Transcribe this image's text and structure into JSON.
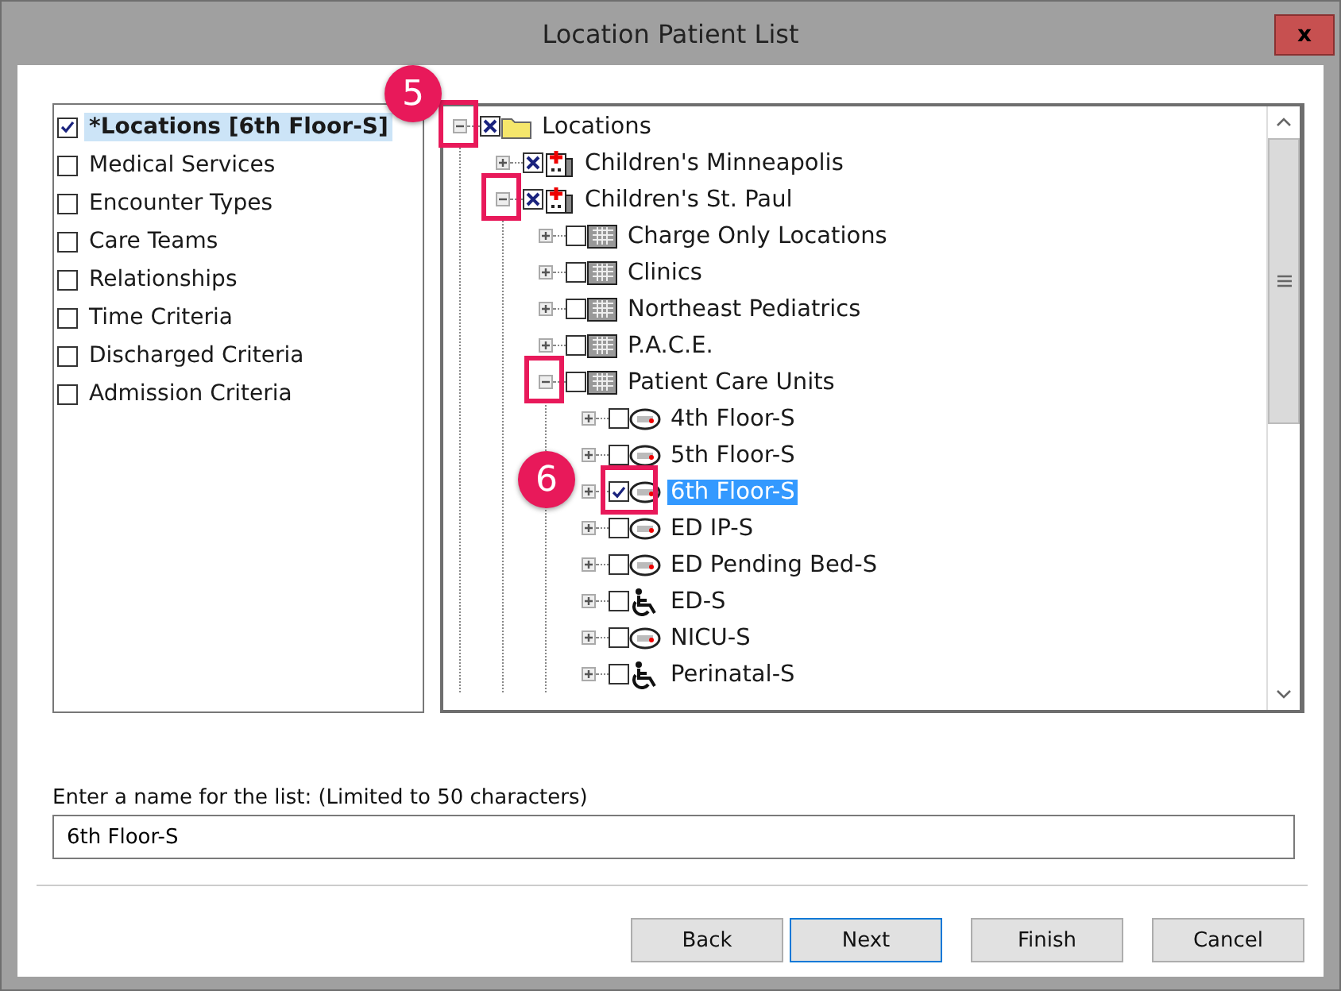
{
  "window": {
    "title": "Location Patient List",
    "close_label": "x"
  },
  "criteria": [
    {
      "label": "*Locations [6th Floor-S]",
      "checked": true,
      "selected": true
    },
    {
      "label": "Medical Services",
      "checked": false,
      "selected": false
    },
    {
      "label": "Encounter Types",
      "checked": false,
      "selected": false
    },
    {
      "label": "Care Teams",
      "checked": false,
      "selected": false
    },
    {
      "label": "Relationships",
      "checked": false,
      "selected": false
    },
    {
      "label": "Time Criteria",
      "checked": false,
      "selected": false
    },
    {
      "label": "Discharged Criteria",
      "checked": false,
      "selected": false
    },
    {
      "label": "Admission Criteria",
      "checked": false,
      "selected": false
    }
  ],
  "tree": [
    {
      "label": "Locations",
      "kind": "folder",
      "checked": true,
      "partial": true,
      "expanded": true,
      "selected": false,
      "expander_highlighted": true,
      "callout": "5",
      "children": [
        {
          "label": "Children's Minneapolis",
          "kind": "hospital",
          "checked": true,
          "partial": true,
          "expanded": false,
          "selected": false
        },
        {
          "label": "Children's St. Paul",
          "kind": "hospital",
          "checked": true,
          "partial": true,
          "expanded": true,
          "selected": false,
          "expander_highlighted": true,
          "children": [
            {
              "label": "Charge Only Locations",
              "kind": "building",
              "checked": false,
              "expanded": false,
              "selected": false
            },
            {
              "label": "Clinics",
              "kind": "building",
              "checked": false,
              "expanded": false,
              "selected": false
            },
            {
              "label": "Northeast Pediatrics",
              "kind": "building",
              "checked": false,
              "expanded": false,
              "selected": false
            },
            {
              "label": "P.A.C.E.",
              "kind": "building",
              "checked": false,
              "expanded": false,
              "selected": false
            },
            {
              "label": "Patient Care Units",
              "kind": "building",
              "checked": false,
              "expanded": true,
              "selected": false,
              "expander_highlighted": true,
              "children": [
                {
                  "label": "4th Floor-S",
                  "kind": "bed",
                  "checked": false,
                  "expanded": false,
                  "selected": false
                },
                {
                  "label": "5th Floor-S",
                  "kind": "bed",
                  "checked": false,
                  "expanded": false,
                  "selected": false
                },
                {
                  "label": "6th Floor-S",
                  "kind": "bed",
                  "checked": true,
                  "expanded": false,
                  "selected": true,
                  "checkbox_highlighted": true,
                  "callout": "6"
                },
                {
                  "label": "ED IP-S",
                  "kind": "bed",
                  "checked": false,
                  "expanded": false,
                  "selected": false
                },
                {
                  "label": "ED Pending Bed-S",
                  "kind": "bed",
                  "checked": false,
                  "expanded": false,
                  "selected": false
                },
                {
                  "label": "ED-S",
                  "kind": "wheelchair",
                  "checked": false,
                  "expanded": false,
                  "selected": false
                },
                {
                  "label": "NICU-S",
                  "kind": "bed",
                  "checked": false,
                  "expanded": false,
                  "selected": false
                },
                {
                  "label": "Perinatal-S",
                  "kind": "wheelchair",
                  "checked": false,
                  "expanded": false,
                  "selected": false
                }
              ]
            }
          ]
        }
      ]
    }
  ],
  "name_field": {
    "label": "Enter a name for the list: (Limited to 50 characters)",
    "value": "6th Floor-S"
  },
  "buttons": [
    {
      "label": "Back",
      "focused": false
    },
    {
      "label": "Next",
      "focused": true
    },
    {
      "label": "Finish",
      "focused": false
    },
    {
      "label": "Cancel",
      "focused": false
    }
  ]
}
